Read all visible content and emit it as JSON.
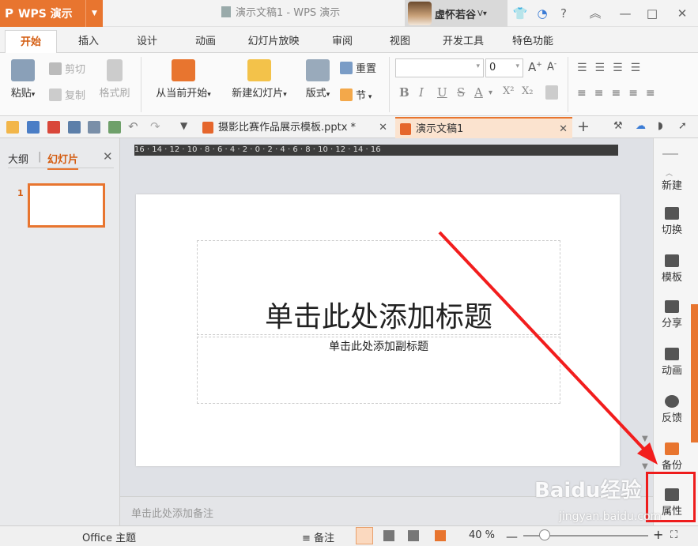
{
  "app": {
    "logo_label": "WPS 演示",
    "window_title": "演示文稿1 - WPS 演示",
    "user_name": "虚怀若谷"
  },
  "window_controls": {
    "help": "?",
    "minimize": "—",
    "maximize": "□",
    "close": "✕"
  },
  "ribbon_tabs": [
    {
      "label": "开始",
      "active": true
    },
    {
      "label": "插入"
    },
    {
      "label": "设计"
    },
    {
      "label": "动画"
    },
    {
      "label": "幻灯片放映"
    },
    {
      "label": "审阅"
    },
    {
      "label": "视图"
    },
    {
      "label": "开发工具"
    },
    {
      "label": "特色功能"
    }
  ],
  "ribbon": {
    "paste": "粘贴",
    "cut": "剪切",
    "copy": "复制",
    "format_painter": "格式刷",
    "start_from_current": "从当前开始",
    "new_slide": "新建幻灯片",
    "layout": "版式",
    "reset": "重置",
    "section": "节",
    "font_size": "0",
    "bold": "B",
    "italic": "I",
    "underline": "U",
    "font_color": "A",
    "superscript": "X²",
    "subscript": "X₂"
  },
  "doc_tabs": [
    {
      "label": "摄影比赛作品展示模板.pptx *",
      "active": false
    },
    {
      "label": "演示文稿1",
      "active": true
    }
  ],
  "left_panel": {
    "tab_outline": "大纲",
    "tab_slides": "幻灯片",
    "slide_number": "1"
  },
  "ruler": {
    "text": "16 · 14 · 12 · 10 · 8 · 6 · 4 · 2 · 0 · 2 · 4 · 6 · 8 · 10 · 12 · 14 · 16"
  },
  "slide": {
    "title_placeholder": "单击此处添加标题",
    "subtitle_placeholder": "单击此处添加副标题"
  },
  "notes_placeholder": "单击此处添加备注",
  "right_sidebar": [
    {
      "label": "新建",
      "icon": "new-icon"
    },
    {
      "label": "切换",
      "icon": "switch-icon"
    },
    {
      "label": "模板",
      "icon": "template-icon"
    },
    {
      "label": "分享",
      "icon": "share-icon"
    },
    {
      "label": "动画",
      "icon": "animation-icon"
    },
    {
      "label": "反馈",
      "icon": "feedback-icon"
    },
    {
      "label": "备份",
      "icon": "backup-icon"
    },
    {
      "label": "属性",
      "icon": "properties-icon"
    }
  ],
  "status_bar": {
    "theme": "Office 主题",
    "notes": "备注",
    "zoom": "40 %"
  },
  "watermark": {
    "brand": "Baidu经验",
    "url": "jingyan.baidu.com"
  },
  "colors": {
    "accent": "#e8752f",
    "highlight": "#ee1c1c",
    "arrow": "#f21d1d"
  }
}
